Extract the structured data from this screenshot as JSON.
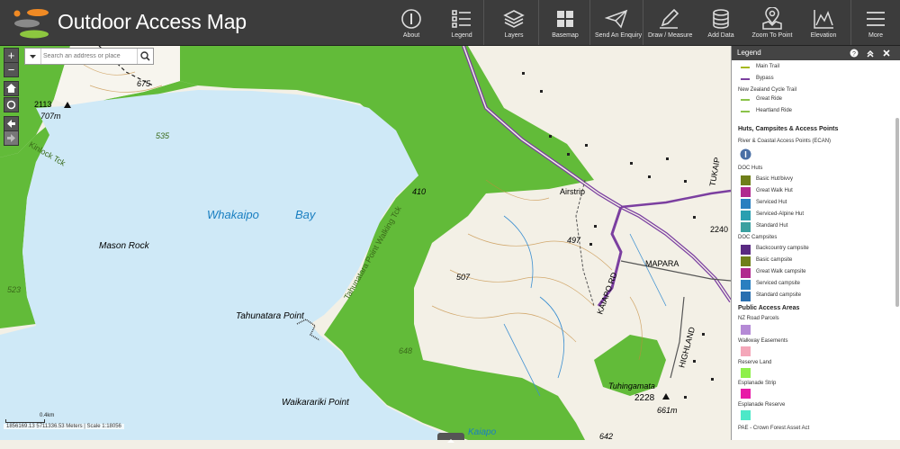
{
  "header": {
    "title": "Outdoor Access Map",
    "tools": [
      {
        "label": "About",
        "icon": "info-icon"
      },
      {
        "label": "Legend",
        "icon": "legend-list-icon"
      },
      {
        "label": "Layers",
        "icon": "layers-icon"
      },
      {
        "label": "Basemap",
        "icon": "basemap-grid-icon"
      },
      {
        "label": "Send An Enquiry",
        "icon": "paper-plane-icon"
      },
      {
        "label": "Draw / Measure",
        "icon": "pencil-icon"
      },
      {
        "label": "Add Data",
        "icon": "database-icon"
      },
      {
        "label": "Zoom To Point",
        "icon": "map-pin-icon"
      },
      {
        "label": "Elevation",
        "icon": "elevation-profile-icon"
      },
      {
        "label": "More",
        "icon": "hamburger-menu-icon"
      }
    ]
  },
  "search": {
    "placeholder": "Search an address or place"
  },
  "map": {
    "controls": {
      "zoom_in": "+",
      "zoom_out": "−"
    },
    "labels": {
      "bay": "Whakaipo",
      "bay2": "Bay",
      "mason": "Mason Rock",
      "tahunatara": "Tahunatara Point",
      "waikarariki": "Waikarariki Point",
      "kaiapo": "Kaiapo",
      "airstrip": "Airstrip",
      "mapara": "MAPARA",
      "kaiapo_rd": "KAIAPO RD",
      "tukaip": "TUKAIP",
      "highland": "HIGHLAND",
      "tuhingamata": "Tuhingamata",
      "walk": "Tahunatara Point Walking Tck",
      "kinlock": "Kinlock Tck",
      "h675": "675",
      "h535": "535",
      "h2113": "2113",
      "h707": "707m",
      "h523": "523",
      "h410": "410",
      "h497": "497",
      "h507": "507",
      "h648": "648",
      "h2228": "2228",
      "h661": "661m",
      "h2240": "2240",
      "h642": "642"
    }
  },
  "status": {
    "coords": "1856169.13 5711336.53 Meters | Scale 1:18056",
    "scale_label": "0.4km"
  },
  "legend": {
    "title": "Legend",
    "items": {
      "main_trail": "Main Trail",
      "bypass": "Bypass",
      "nzct": "New Zealand Cycle Trail",
      "great_ride": "Great Ride",
      "heartland": "Heartland Ride",
      "huts_heading": "Huts, Campsites & Access Points",
      "ecan": "River & Coastal Access Points (ECAN)",
      "doc_huts": "DOC Huts",
      "hut_basic": "Basic Hut/bivvy",
      "hut_great": "Great Walk Hut",
      "hut_serviced": "Serviced Hut",
      "hut_alpine": "Serviced-Alpine Hut",
      "hut_standard": "Standard Hut",
      "doc_camps": "DOC Campsites",
      "camp_back": "Backcountry campsite",
      "camp_basic": "Basic campsite",
      "camp_great": "Great Walk campsite",
      "camp_serviced": "Serviced campsite",
      "camp_standard": "Standard campsite",
      "pub_heading": "Public Access Areas",
      "road_parcels": "NZ Road Parcels",
      "walkway": "Walkway Easements",
      "reserve": "Reserve Land",
      "esp_strip": "Esplanade Strip",
      "esp_reserve": "Esplanade Reserve",
      "pae": "PAE - Crown Forest Asset Act"
    },
    "colors": {
      "main_trail": "#a6b81f",
      "bypass": "#7b3fa0",
      "great_ride": "#8bc34a",
      "heartland": "#8bc34a",
      "hut_basic": "#6f7f1a",
      "hut_great": "#b02a8f",
      "hut_serviced": "#2a7fc0",
      "hut_alpine": "#2a9fb0",
      "hut_standard": "#3aa0a0",
      "camp_back": "#5a2a82",
      "camp_basic": "#6f7f1a",
      "camp_great": "#b02a8f",
      "camp_serviced": "#2a7fc0",
      "camp_standard": "#2a6fb0",
      "road_parcels": "#b58ad6",
      "walkway": "#f4a7b9",
      "reserve": "#8ef04a",
      "esp_strip": "#e81aa7",
      "esp_reserve": "#4de8c8"
    }
  }
}
